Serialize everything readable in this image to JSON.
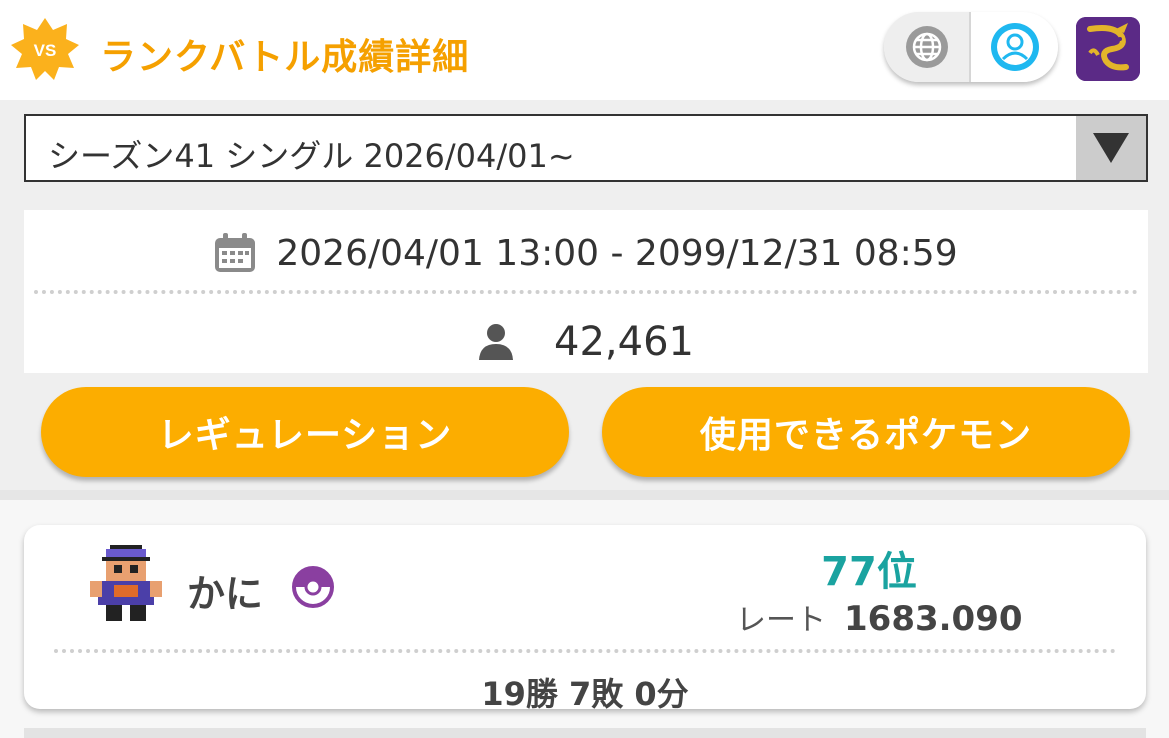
{
  "header": {
    "badge_text": "VS",
    "title": "ランクバトル成績詳細",
    "icons": [
      "globe-icon",
      "profile-icon",
      "avatar-dragon-icon"
    ],
    "accent_color": "#f5a000"
  },
  "season_select": {
    "selected": "シーズン41 シングル 2026/04/01~",
    "arrow_icon": "triangle-down-icon"
  },
  "info": {
    "date_range": "2026/04/01 13:00 - 2099/12/31 08:59",
    "date_icon": "calendar-icon",
    "participants": "42,461",
    "participants_icon": "person-icon"
  },
  "buttons": {
    "regulation": "レギュレーション",
    "usable_pokemon": "使用できるポケモン",
    "color": "#fcad00"
  },
  "player": {
    "name": "かに",
    "rank": "77位",
    "rate_label": "レート",
    "rate_value": "1683.090",
    "record": "19勝 7敗 0分",
    "rank_color": "#1aa3a0",
    "icons": [
      "trainer-sprite-icon",
      "pokeball-icon"
    ]
  }
}
